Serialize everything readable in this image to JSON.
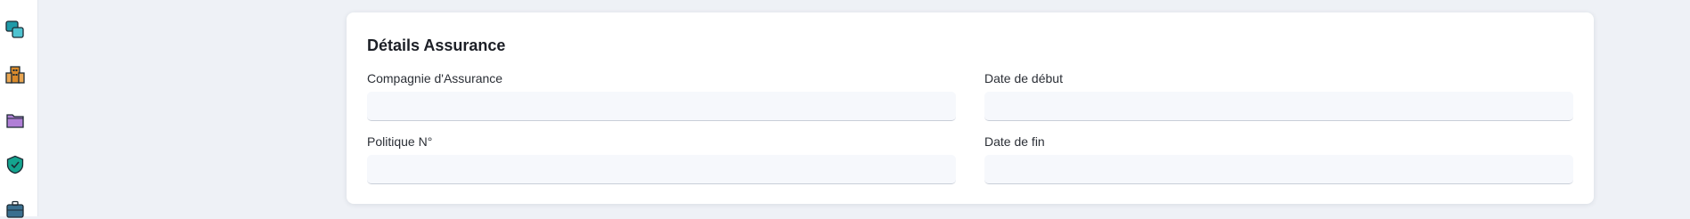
{
  "sidebar": {
    "items": [
      {
        "icon": "chat-bubbles-icon",
        "color": "#1e9aa8"
      },
      {
        "icon": "building-icon",
        "color": "#d98a2b"
      },
      {
        "icon": "folder-icon",
        "color": "#b07fd6"
      },
      {
        "icon": "shield-check-icon",
        "color": "#14a48f"
      },
      {
        "icon": "briefcase-icon",
        "color": "#3a6f8f"
      }
    ]
  },
  "card": {
    "title": "Détails Assurance",
    "fields": {
      "company": {
        "label": "Compagnie d'Assurance",
        "value": "",
        "placeholder": ""
      },
      "start_date": {
        "label": "Date de début",
        "value": "",
        "placeholder": ""
      },
      "policy": {
        "label": "Politique N°",
        "value": "",
        "placeholder": ""
      },
      "end_date": {
        "label": "Date de fin",
        "value": "",
        "placeholder": ""
      }
    }
  },
  "colors": {
    "page_bg": "#eef1f6",
    "card_bg": "#ffffff",
    "input_bg": "#f6f8fc"
  }
}
